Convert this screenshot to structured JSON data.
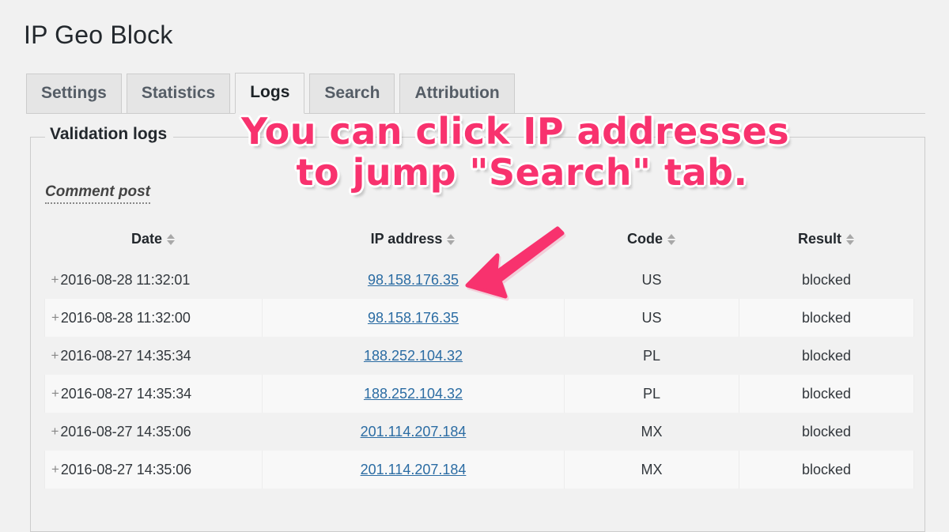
{
  "header": {
    "title": "IP Geo Block"
  },
  "tabs": [
    {
      "label": "Settings",
      "active": false
    },
    {
      "label": "Statistics",
      "active": false
    },
    {
      "label": "Logs",
      "active": true
    },
    {
      "label": "Search",
      "active": false
    },
    {
      "label": "Attribution",
      "active": false
    }
  ],
  "panel": {
    "legend": "Validation logs",
    "section_label": "Comment post"
  },
  "table": {
    "columns": [
      {
        "key": "date",
        "label": "Date",
        "sortable": true
      },
      {
        "key": "ip",
        "label": "IP address",
        "sortable": true
      },
      {
        "key": "code",
        "label": "Code",
        "sortable": true
      },
      {
        "key": "result",
        "label": "Result",
        "sortable": true
      }
    ],
    "expand_glyph": "+",
    "rows": [
      {
        "date": "2016-08-28 11:32:01",
        "ip": "98.158.176.35",
        "code": "US",
        "result": "blocked"
      },
      {
        "date": "2016-08-28 11:32:00",
        "ip": "98.158.176.35",
        "code": "US",
        "result": "blocked"
      },
      {
        "date": "2016-08-27 14:35:34",
        "ip": "188.252.104.32",
        "code": "PL",
        "result": "blocked"
      },
      {
        "date": "2016-08-27 14:35:34",
        "ip": "188.252.104.32",
        "code": "PL",
        "result": "blocked"
      },
      {
        "date": "2016-08-27 14:35:06",
        "ip": "201.114.207.184",
        "code": "MX",
        "result": "blocked"
      },
      {
        "date": "2016-08-27 14:35:06",
        "ip": "201.114.207.184",
        "code": "MX",
        "result": "blocked"
      }
    ]
  },
  "annotation": {
    "line1": "You can click IP addresses",
    "line2": "to jump \"Search\" tab.",
    "color": "#f8326e",
    "outline_color": "#ffffff",
    "arrow_color": "#f8326e"
  },
  "colors": {
    "page_background": "#f1f1f1",
    "tab_inactive_background": "#e5e5e5",
    "tab_active_background": "#f1f1f1",
    "border": "#cccccc",
    "link": "#2b6ca3",
    "row_alt_background": "#f8f8f8",
    "text": "#32373c"
  }
}
